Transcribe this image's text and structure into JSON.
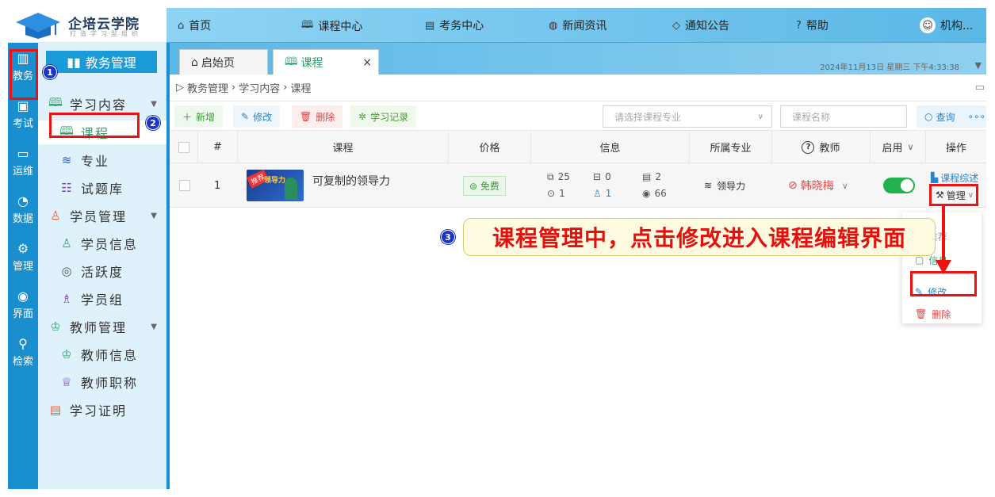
{
  "logo": {
    "name": "企培云学院",
    "slogan": "打造学习型组织"
  },
  "topnav": [
    {
      "icon": "home-icon",
      "glyph": "⌂",
      "label": "首页"
    },
    {
      "icon": "book-icon",
      "glyph": "🕮",
      "label": "课程中心"
    },
    {
      "icon": "exam-icon",
      "glyph": "▤",
      "label": "考务中心"
    },
    {
      "icon": "news-icon",
      "glyph": "◍",
      "label": "新闻资讯"
    },
    {
      "icon": "notice-icon",
      "glyph": "◇",
      "label": "通知公告"
    },
    {
      "icon": "help-icon",
      "glyph": "?",
      "label": "帮助"
    },
    {
      "icon": "avatar",
      "glyph": "☺",
      "label": "机构..."
    }
  ],
  "iconbar": [
    {
      "icon": "edu-icon",
      "glyph": "▥",
      "label": "教务"
    },
    {
      "icon": "exam-icon",
      "glyph": "▣",
      "label": "考试"
    },
    {
      "icon": "ops-icon",
      "glyph": "▭",
      "label": "运维"
    },
    {
      "icon": "data-icon",
      "glyph": "◔",
      "label": "数据"
    },
    {
      "icon": "manage-icon",
      "glyph": "⚙",
      "label": "管理"
    },
    {
      "icon": "ui-icon",
      "glyph": "◉",
      "label": "界面"
    },
    {
      "icon": "search-icon",
      "glyph": "⚲",
      "label": "检索"
    }
  ],
  "menu": {
    "head": "教务管理",
    "items": [
      {
        "label": "学习内容",
        "level": 1,
        "glyph": "🕮",
        "arrow": "▼"
      },
      {
        "label": "课程",
        "level": 2,
        "glyph": "🕮",
        "active": true
      },
      {
        "label": "专业",
        "level": 2,
        "glyph": "≋"
      },
      {
        "label": "试题库",
        "level": 2,
        "glyph": "☷"
      },
      {
        "label": "学员管理",
        "level": 1,
        "glyph": "♙",
        "arrow": "▼"
      },
      {
        "label": "学员信息",
        "level": 2,
        "glyph": "♙"
      },
      {
        "label": "活跃度",
        "level": 2,
        "glyph": "◎"
      },
      {
        "label": "学员组",
        "level": 2,
        "glyph": "♗"
      },
      {
        "label": "教师管理",
        "level": 1,
        "glyph": "♔",
        "arrow": "▼"
      },
      {
        "label": "教师信息",
        "level": 2,
        "glyph": "♔"
      },
      {
        "label": "教师职称",
        "level": 2,
        "glyph": "♕"
      },
      {
        "label": "学习证明",
        "level": 1,
        "glyph": "▤"
      }
    ]
  },
  "tabs": [
    {
      "label": "启始页",
      "glyph": "⌂"
    },
    {
      "label": "课程",
      "glyph": "🕮",
      "close": "×"
    }
  ],
  "datetime": "2024年11月13日 星期三 下午4:33:38",
  "breadcrumb": [
    "教务管理",
    "学习内容",
    "课程"
  ],
  "toolbar": {
    "add": "新增",
    "edit": "修改",
    "delete": "删除",
    "log": "学习记录"
  },
  "filters": {
    "major_placeholder": "请选择课程专业",
    "name_placeholder": "课程名称",
    "query": "查询"
  },
  "table": {
    "headers": [
      "#",
      "课程",
      "价格",
      "信息",
      "所属专业",
      "教师",
      "启用",
      "操作"
    ],
    "rows": [
      {
        "index": "1",
        "thumb_tag": "推荐",
        "thumb_title": "领导力",
        "title": "可复制的领导力",
        "price": "免费",
        "info": {
          "a": "25",
          "b": "0",
          "c": "2",
          "d": "1",
          "e": "1",
          "f": "66"
        },
        "major": "领导力",
        "teacher": "韩晓梅",
        "enabled": true,
        "op1": "课程综述",
        "op2": "管理"
      }
    ]
  },
  "dropdown": [
    {
      "label": "推荐",
      "glyph": "☆",
      "color": "#999"
    },
    {
      "label": "信息",
      "glyph": "▢",
      "color": "#2aa26a"
    },
    {
      "label": "修改",
      "glyph": "✎",
      "color": "#2a82c8"
    },
    {
      "label": "删除",
      "glyph": "🗑",
      "color": "#d44"
    }
  ],
  "annotation": {
    "n1": "1",
    "n2": "2",
    "n3": "3",
    "text": "课程管理中，点击修改进入课程编辑界面"
  },
  "colors": {
    "accent": "#1a8fd0",
    "green": "#2aa26a",
    "red": "#e11"
  }
}
